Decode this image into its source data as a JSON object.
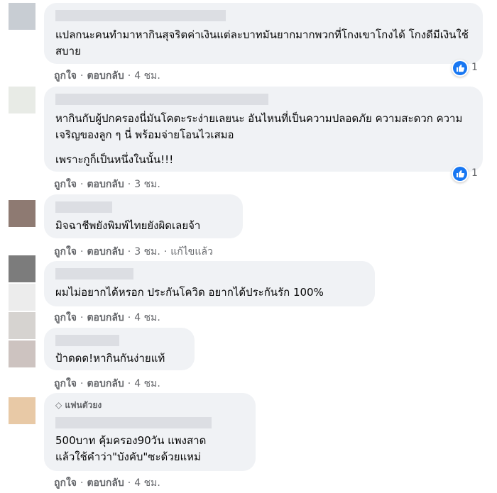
{
  "comments": [
    {
      "text": "แปลกนะคนทำมาหากินสุจริตค่าเงินแต่ละบาทมันยากมากพวกที่โกงเขาโกงได้ โกงดีมีเงินใช้สบาย",
      "like": "ถูกใจ",
      "reply": "ตอบกลับ",
      "time": "4 ชม.",
      "reactions": "1"
    },
    {
      "text": "หากินกับผู้ปกครองนี่มันโคตะระง่ายเลยนะ อันไหนที่เป็นความปลอดภัย ความสะดวก ความเจริญของลูก ๆ นี่ พร้อมจ่ายโอนไวเสมอ",
      "text2": "เพราะกูก็เป็นหนึ่งในนั้น!!!",
      "like": "ถูกใจ",
      "reply": "ตอบกลับ",
      "time": "3 ชม.",
      "reactions": "1"
    },
    {
      "text": "มิจฉาชีพยังพิมพ์ไทยยังผิดเลยจ้า",
      "like": "ถูกใจ",
      "reply": "ตอบกลับ",
      "time": "3 ชม.",
      "edited": "แก้ไขแล้ว"
    },
    {
      "text": "ผมไม่อยากได้หรอก ประกันโควิด อยากได้ประกันรัก 100%",
      "like": "ถูกใจ",
      "reply": "ตอบกลับ",
      "time": "4 ชม."
    },
    {
      "text": "ป้าดดด!หากินกันง่ายแท้",
      "like": "ถูกใจ",
      "reply": "ตอบกลับ",
      "time": "4 ชม."
    },
    {
      "badge": "แฟนตัวยง",
      "text": "500บาท คุ้มครอง90วัน แพงสาด แล้วใช้คำว่า\"บังคับ\"ซะด้วยแหม่",
      "like": "ถูกใจ",
      "reply": "ตอบกลับ",
      "time": "4 ชม."
    }
  ],
  "colors": {
    "like_blue": "#1877f2",
    "bubble": "#f0f2f5",
    "meta": "#65676b"
  }
}
